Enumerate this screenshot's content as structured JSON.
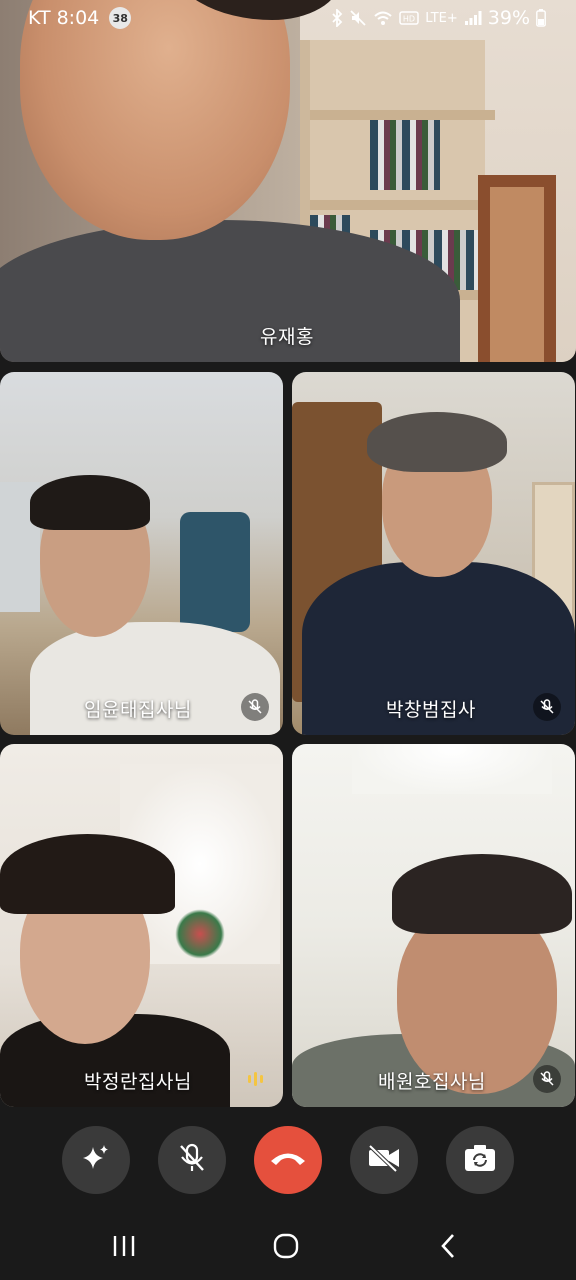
{
  "status_bar": {
    "carrier": "KT",
    "time": "8:04",
    "notification_count": "38",
    "network": "LTE+",
    "battery_percent": "39%"
  },
  "main_speaker": {
    "name": "유재홍"
  },
  "participants": [
    {
      "name": "임윤태집사님",
      "mic": "muted"
    },
    {
      "name": "박창범집사",
      "mic": "muted"
    },
    {
      "name": "박정란집사님",
      "mic": "speaking"
    },
    {
      "name": "배원호집사님",
      "mic": "muted"
    }
  ],
  "controls": {
    "effects": "sparkle-icon",
    "mic": "mic-off-icon",
    "end_call": "end-call-icon",
    "camera": "video-off-icon",
    "flip": "camera-flip-icon"
  },
  "colors": {
    "end_call": "#e5503d",
    "control_bg": "#3a3a3a",
    "speaking": "#f4c542",
    "background": "#1a1a1a"
  }
}
